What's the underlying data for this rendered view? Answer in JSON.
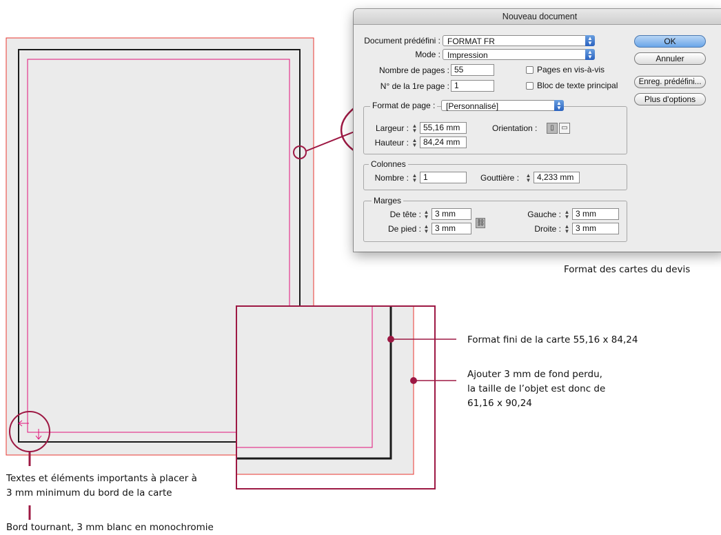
{
  "colors": {
    "crimson": "#9d1843",
    "magenta": "#e0117a",
    "bleed_red": "#e8352f",
    "black": "#1a1a1a",
    "gray_fill": "#ebebeb"
  },
  "dialog": {
    "title": "Nouveau document",
    "preset_label": "Document prédéfini :",
    "preset_value": "FORMAT FR",
    "mode_label": "Mode :",
    "mode_value": "Impression",
    "pages_label": "Nombre de pages :",
    "pages_value": "55",
    "first_page_label": "N° de la 1re page :",
    "first_page_value": "1",
    "facing_pages_label": "Pages en vis-à-vis",
    "facing_pages_checked": false,
    "master_text_label": "Bloc de texte principal",
    "master_text_checked": false,
    "page_format_label": "Format de page :",
    "page_format_value": "[Personnalisé]",
    "width_label": "Largeur :",
    "width_value": "55,16 mm",
    "height_label": "Hauteur :",
    "height_value": "84,24 mm",
    "orientation_label": "Orientation :",
    "columns_title": "Colonnes",
    "columns_count_label": "Nombre :",
    "columns_count_value": "1",
    "gutter_label": "Gouttière :",
    "gutter_value": "4,233 mm",
    "margins_title": "Marges",
    "top_label": "De tête :",
    "top_value": "3 mm",
    "bottom_label": "De pied :",
    "bottom_value": "3 mm",
    "left_label": "Gauche :",
    "left_value": "3 mm",
    "right_label": "Droite :",
    "right_value": "3 mm",
    "ok_label": "OK",
    "cancel_label": "Annuler",
    "save_preset_label": "Enreg. prédéfini...",
    "more_options_label": "Plus d'options"
  },
  "captions": {
    "dialog_caption": "Format des cartes du devis",
    "finished_format": "Format fini de la carte 55,16 x 84,24",
    "bleed_line1": "Ajouter 3 mm de fond perdu,",
    "bleed_line2": "la taille de l’objet est donc de",
    "bleed_line3": "61,16 x 90,24",
    "safe_zone_line1": "Textes et éléments importants à placer à",
    "safe_zone_line2": "3 mm minimum du bord de la carte",
    "bord_tournant": "Bord tournant, 3 mm blanc en monochromie"
  }
}
